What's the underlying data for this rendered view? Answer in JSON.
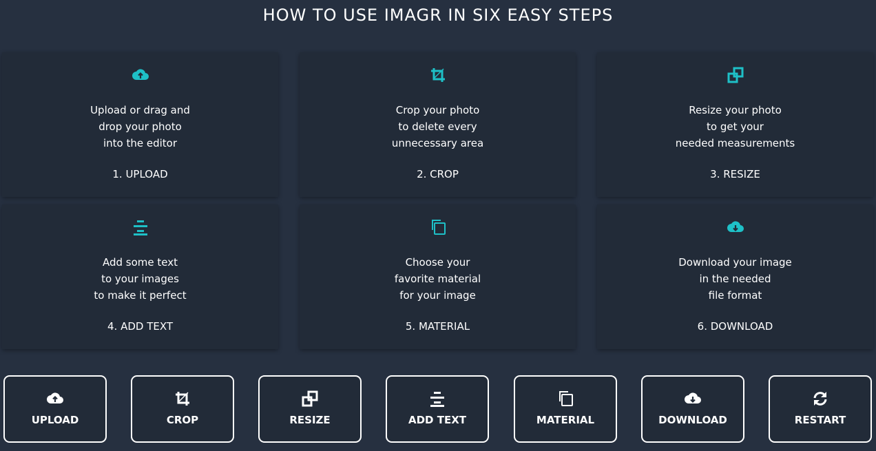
{
  "title": "HOW TO USE IMAGR IN SIX EASY STEPS",
  "colors": {
    "accent": "#1ec0c7",
    "background": "#263040",
    "card": "#222b38",
    "text": "#ffffff"
  },
  "steps": [
    {
      "icon": "cloud-upload-icon",
      "lines": [
        "Upload or drag and",
        "drop your photo",
        "into the editor"
      ],
      "step_label": "1. UPLOAD"
    },
    {
      "icon": "crop-icon",
      "lines": [
        "Crop your photo",
        "to delete every",
        "unnecessary area"
      ],
      "step_label": "2. CROP"
    },
    {
      "icon": "resize-icon",
      "lines": [
        "Resize your photo",
        "to get your",
        "needed measurements"
      ],
      "step_label": "3. RESIZE"
    },
    {
      "icon": "text-align-center-icon",
      "lines": [
        "Add some text",
        "to your images",
        "to make it perfect"
      ],
      "step_label": "4. ADD TEXT"
    },
    {
      "icon": "copy-icon",
      "lines": [
        "Choose your",
        "favorite material",
        "for your image"
      ],
      "step_label": "5. MATERIAL"
    },
    {
      "icon": "cloud-download-icon",
      "lines": [
        "Download your image",
        "in the needed",
        "file format"
      ],
      "step_label": "6. DOWNLOAD"
    }
  ],
  "toolbar": [
    {
      "icon": "cloud-upload-icon",
      "label": "UPLOAD"
    },
    {
      "icon": "crop-icon",
      "label": "CROP"
    },
    {
      "icon": "resize-icon",
      "label": "RESIZE"
    },
    {
      "icon": "text-align-center-icon",
      "label": "ADD TEXT"
    },
    {
      "icon": "copy-icon",
      "label": "MATERIAL"
    },
    {
      "icon": "cloud-download-icon",
      "label": "DOWNLOAD"
    },
    {
      "icon": "refresh-icon",
      "label": "RESTART"
    }
  ]
}
